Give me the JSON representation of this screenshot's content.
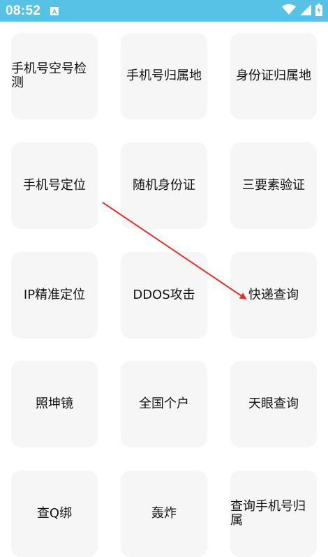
{
  "status_bar": {
    "time": "08:52",
    "background_color": "#58c2e6",
    "icons": [
      "notification-a-icon",
      "wifi-icon",
      "cellular-signal-icon",
      "battery-charging-icon"
    ]
  },
  "tiles": [
    {
      "label": "手机号空号检测"
    },
    {
      "label": "手机号归属地"
    },
    {
      "label": "身份证归属地"
    },
    {
      "label": "手机号定位"
    },
    {
      "label": "随机身份证"
    },
    {
      "label": "三要素验证"
    },
    {
      "label": "IP精准定位"
    },
    {
      "label": "DDOS攻击"
    },
    {
      "label": "快递查询"
    },
    {
      "label": "照坤镜"
    },
    {
      "label": "全国个户"
    },
    {
      "label": "天眼查询"
    },
    {
      "label": "查Q绑"
    },
    {
      "label": "轰炸"
    },
    {
      "label": "查询手机号归属"
    }
  ],
  "annotation": {
    "arrow_color": "#e8302a",
    "icon": "red-arrow-annotation"
  }
}
